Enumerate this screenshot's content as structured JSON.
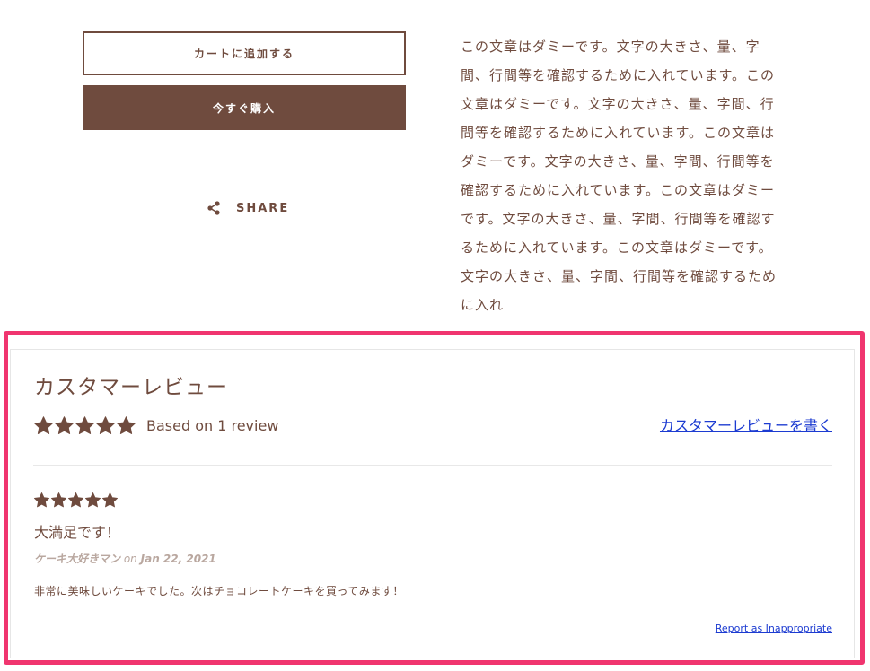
{
  "product": {
    "add_to_cart_label": "カートに追加する",
    "buy_now_label": "今すぐ購入",
    "share_label": "SHARE",
    "description": "この文章はダミーです。文字の大きさ、量、字間、行間等を確認するために入れています。この文章はダミーです。文字の大きさ、量、字間、行間等を確認するために入れています。この文章はダミーです。文字の大きさ、量、字間、行間等を確認するために入れています。この文章はダミーです。文字の大きさ、量、字間、行間等を確認するために入れています。この文章はダミーです。文字の大きさ、量、字間、行間等を確認するために入れ"
  },
  "reviews": {
    "title": "カスタマーレビュー",
    "average_rating": 5,
    "max_rating": 5,
    "summary_text": "Based on 1 review",
    "write_review_label": "カスタマーレビューを書く",
    "items": [
      {
        "rating": 5,
        "title": "大満足です！",
        "author": "ケーキ大好きマン",
        "on_label": "on",
        "date": "Jan 22, 2021",
        "body": "非常に美味しいケーキでした。次はチョコレートケーキを買ってみます！",
        "report_label": "Report as Inappropriate"
      }
    ]
  },
  "colors": {
    "brand_brown": "#6f4b3e",
    "link_blue": "#1c3bd1",
    "highlight_pink": "#f0356f",
    "meta_gray": "#b9a79f"
  },
  "icons": {
    "share": "share-icon",
    "star": "star-icon"
  }
}
